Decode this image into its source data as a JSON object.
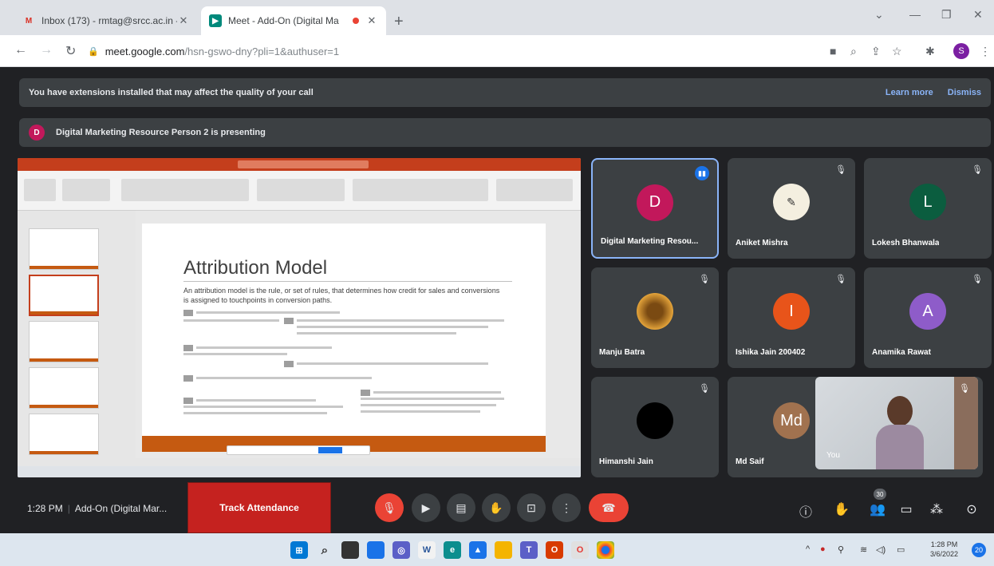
{
  "browser": {
    "tabs": [
      {
        "title": "Inbox (173) - rmtag@srcc.ac.in -",
        "favicon": "gmail-icon",
        "active": false
      },
      {
        "title": "Meet - Add-On (Digital Ma",
        "favicon": "meet-icon",
        "active": true,
        "recording": true
      }
    ],
    "address": {
      "host": "meet.google.com",
      "path": "/hsn-gswo-dny?pli=1&authuser=1"
    },
    "profile_initial": "S"
  },
  "meet": {
    "extension_banner": {
      "text": "You have extensions installed that may affect the quality of your call",
      "learn_more": "Learn more",
      "dismiss": "Dismiss"
    },
    "presenting_banner": {
      "initial": "D",
      "text": "Digital Marketing Resource Person 2 is presenting"
    },
    "slide": {
      "title": "Attribution Model",
      "subtitle": "An attribution model is the rule, or set of rules, that determines how credit for sales and conversions is assigned to touchpoints in conversion paths."
    },
    "participants": [
      {
        "name": "Digital Marketing Resou...",
        "initial": "D",
        "color": "#c2185b",
        "speaking": true
      },
      {
        "name": "Aniket Mishra",
        "initial": "",
        "color": "#f4efe0",
        "muted": true
      },
      {
        "name": "Lokesh Bhanwala",
        "initial": "L",
        "color": "#0b5d3f",
        "muted": true
      },
      {
        "name": "Manju Batra",
        "initial": "",
        "color": "#c9891f",
        "muted": true
      },
      {
        "name": "Ishika Jain 200402",
        "initial": "I",
        "color": "#e8541a",
        "muted": true
      },
      {
        "name": "Anamika Rawat",
        "initial": "A",
        "color": "#8e5cc9",
        "muted": true
      },
      {
        "name": "Himanshi Jain",
        "initial": "",
        "color": "#000000",
        "muted": true
      },
      {
        "name": "Md Saif",
        "initial": "Md",
        "color": "#a1724f",
        "muted": false
      }
    ],
    "self_view_label": "You",
    "controls": {
      "time": "1:28 PM",
      "meeting_name": "Add-On (Digital Mar...",
      "track_attendance": "Track Attendance",
      "participant_count": "30"
    }
  },
  "taskbar": {
    "time": "1:28 PM",
    "date": "3/6/2022",
    "notifications": "20"
  }
}
